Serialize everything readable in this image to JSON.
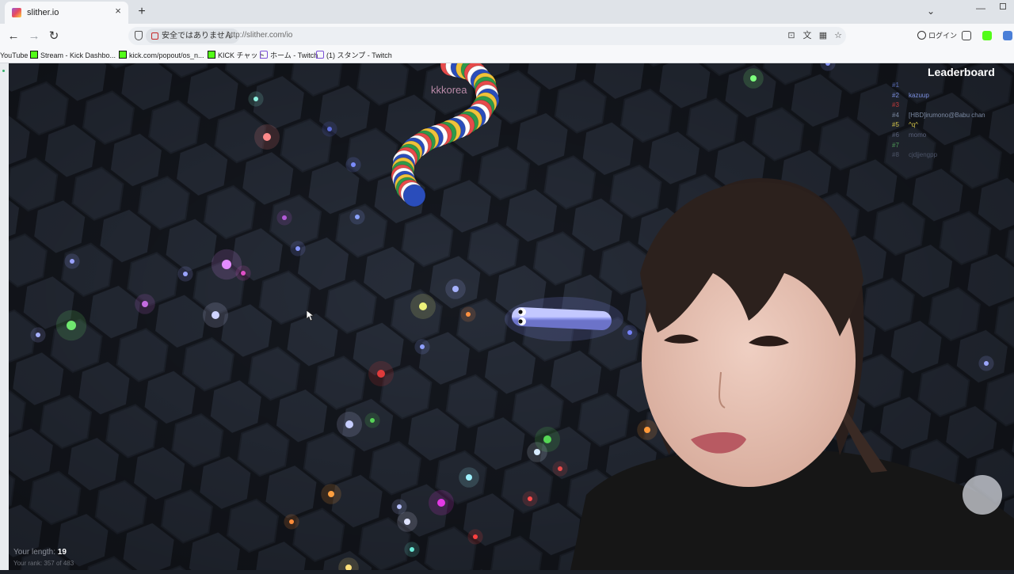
{
  "tab": {
    "title": "slither.io",
    "close": "×",
    "new_tab": "+"
  },
  "window": {
    "chevron": "⌄",
    "minimize": "—"
  },
  "nav": {
    "back": "←",
    "forward": "→",
    "reload": "↻"
  },
  "address": {
    "security_label": "安全ではありません",
    "url": "http://slither.com/io"
  },
  "toolbar": {
    "login_label": "ログイン"
  },
  "bookmarks": [
    {
      "label": "YouTube",
      "icon": "none"
    },
    {
      "label": "Stream - Kick Dashbo...",
      "icon": "kick-icon"
    },
    {
      "label": "kick.com/popout/os_n...",
      "icon": "kick-icon"
    },
    {
      "label": "KICK チャット",
      "icon": "kick-icon"
    },
    {
      "label": "ホーム - Twitch",
      "icon": "twitch-icon"
    },
    {
      "label": "(1) スタンプ - Twitch",
      "icon": "twitch-icon"
    }
  ],
  "game": {
    "leaderboard_title": "Leaderboard",
    "leaderboard": [
      {
        "rank": "#1",
        "name": "",
        "color": "#5a6db8"
      },
      {
        "rank": "#2",
        "name": "kazuup",
        "color": "#7b8fe0"
      },
      {
        "rank": "#3",
        "name": "",
        "color": "#c23a3a"
      },
      {
        "rank": "#4",
        "name": "[HBD]irumono@Babu chan",
        "color": "#7c8aa3"
      },
      {
        "rank": "#5",
        "name": "^q^",
        "color": "#d6c64a"
      },
      {
        "rank": "#6",
        "name": "momo",
        "color": "#596079"
      },
      {
        "rank": "#7",
        "name": "",
        "color": "#4f9a58"
      },
      {
        "rank": "#8",
        "name": "cjdjjengpp",
        "color": "#4c5468"
      }
    ],
    "enemy_snake_name": "kkkorea",
    "length_label": "Your length:",
    "length_value": "19",
    "rank_text": "Your rank: 357 of 483"
  },
  "colors": {
    "player_snake": "#9ea6f2",
    "enemy_stripes": [
      "#e74b4b",
      "#ffffff",
      "#2a4dbb",
      "#f0c23a",
      "#2e9a4a"
    ]
  }
}
